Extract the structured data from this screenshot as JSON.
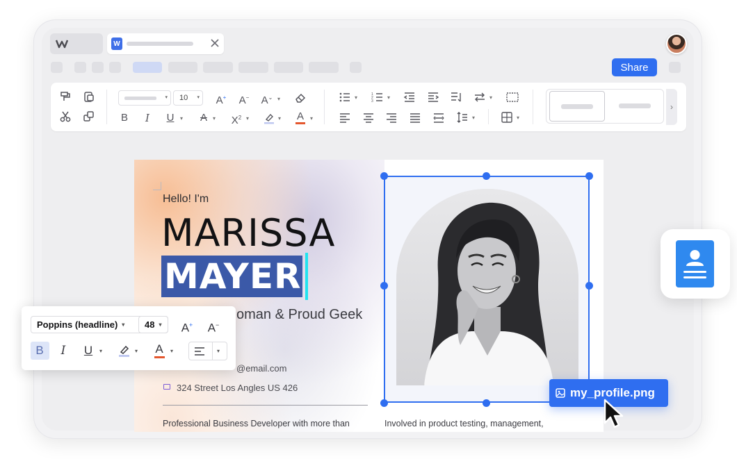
{
  "colors": {
    "accent": "#2f6ef0",
    "highlight": "#3b59a8",
    "caret": "#22e3ef",
    "font_color_underline": "#e4572e"
  },
  "tab": {
    "app_icon": "wps-logo-icon",
    "doc_icon_letter": "W",
    "close_icon": "close-icon"
  },
  "header": {
    "share_label": "Share",
    "avatar": "user-avatar"
  },
  "toolbar": {
    "font_size": "10",
    "icons": [
      "format-painter-icon",
      "paste-icon",
      "cut-icon",
      "copy-icon",
      "bold-icon",
      "italic-icon",
      "underline-icon",
      "strikethrough-icon",
      "superscript-icon",
      "highlight-icon",
      "font-color-icon",
      "increase-font-icon",
      "decrease-font-icon",
      "change-case-icon",
      "eraser-icon",
      "bullets-icon",
      "numbering-icon",
      "decrease-indent-icon",
      "increase-indent-icon",
      "sort-icon",
      "text-direction-icon",
      "columns-icon",
      "align-left-icon",
      "align-center-icon",
      "align-right-icon",
      "justify-icon",
      "distributed-icon",
      "line-spacing-icon",
      "borders-icon",
      "chevron-right-icon"
    ]
  },
  "document": {
    "greeting": "Hello! I'm",
    "first_name": "MARISSA",
    "last_name": "MAYER",
    "tagline": "oman & Proud Geek",
    "email": "@email.com",
    "address": "324 Street Los Angles US 426",
    "body_left": "Professional Business Developer with more than",
    "body_right": "Involved in product testing, management,"
  },
  "image": {
    "filename": "my_profile.png"
  },
  "format_popup": {
    "font_family": "Poppins (headline)",
    "font_size": "48"
  }
}
